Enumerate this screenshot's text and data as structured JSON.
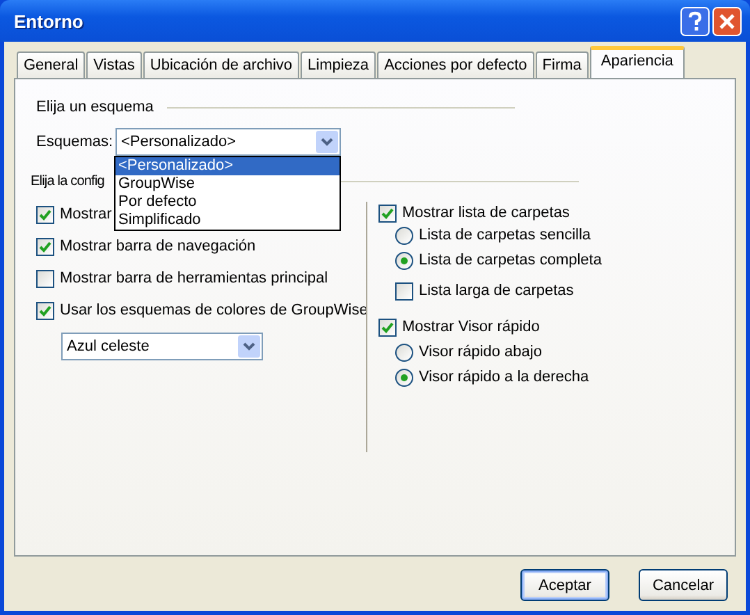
{
  "window": {
    "title": "Entorno"
  },
  "tabs": [
    {
      "label": "General",
      "selected": false
    },
    {
      "label": "Vistas",
      "selected": false
    },
    {
      "label": "Ubicación de archivo",
      "selected": false
    },
    {
      "label": "Limpieza",
      "selected": false
    },
    {
      "label": "Acciones por defecto",
      "selected": false
    },
    {
      "label": "Firma",
      "selected": false
    },
    {
      "label": "Apariencia",
      "selected": true
    }
  ],
  "scheme_section": {
    "heading": "Elija un esquema",
    "label": "Esquemas:",
    "value": "<Personalizado>",
    "options": [
      {
        "label": "<Personalizado>",
        "selected": true
      },
      {
        "label": "GroupWise",
        "selected": false
      },
      {
        "label": "Por defecto",
        "selected": false
      },
      {
        "label": "Simplificado",
        "selected": false
      }
    ]
  },
  "config_section": {
    "heading": "Elija la config",
    "left_options": [
      {
        "kind": "checkbox",
        "label": "Mostrar",
        "checked": true
      },
      {
        "kind": "checkbox",
        "label": "Mostrar barra de navegación",
        "checked": true
      },
      {
        "kind": "checkbox",
        "label": "Mostrar barra de herramientas principal",
        "checked": false
      },
      {
        "kind": "checkbox",
        "label": "Usar los esquemas de colores de GroupWise",
        "checked": true
      },
      {
        "kind": "combo",
        "value": "Azul celeste"
      }
    ],
    "right_options": [
      {
        "kind": "checkbox",
        "label": "Mostrar lista de carpetas",
        "checked": true,
        "children": [
          {
            "kind": "radio",
            "label": "Lista de carpetas sencilla",
            "selected": false
          },
          {
            "kind": "radio",
            "label": "Lista de carpetas completa",
            "selected": true
          },
          {
            "kind": "checkbox",
            "label": "Lista larga de carpetas",
            "checked": false
          }
        ]
      },
      {
        "kind": "checkbox",
        "label": "Mostrar Visor rápido",
        "checked": true,
        "children": [
          {
            "kind": "radio",
            "label": "Visor rápido abajo",
            "selected": false
          },
          {
            "kind": "radio",
            "label": "Visor rápido a la derecha",
            "selected": true
          }
        ]
      }
    ]
  },
  "buttons": [
    {
      "label": "Aceptar",
      "default": true
    },
    {
      "label": "Cancelar",
      "default": false
    }
  ]
}
